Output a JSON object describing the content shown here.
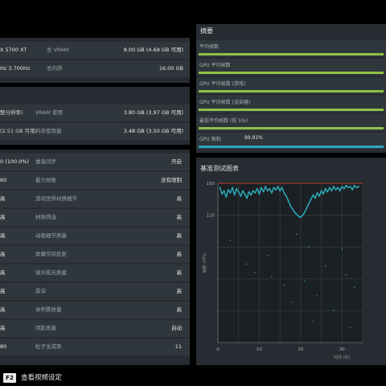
{
  "top_left": {
    "gpu": "X 5700 XT",
    "cpu": "Hz 3.700Hz",
    "vram_label": "总 VRAM",
    "vram_value": "8.00 GB (4.68 GB 可用)",
    "ram_label": "总内存",
    "ram_value": "16.00 GB"
  },
  "mid_left": {
    "left1": "整分辨率)",
    "left2": "(2.51 GB 可用)",
    "vram_use_label": "VRAM 使用",
    "vram_use_value": "3.80 GB (3.97 GB 可用)",
    "mem_use_label": "内存使用量",
    "mem_use_value": "3.48 GB (3.50 GB 可用)"
  },
  "summary": {
    "title": "摘要",
    "rows": [
      {
        "label": "平均帧数",
        "fill": 1.0,
        "color": "#8fc146"
      },
      {
        "label": "GPU 平均帧数",
        "fill": 1.0,
        "color": "#8fc146"
      },
      {
        "label": "GPU 平均帧数 (游戏)",
        "fill": 1.0,
        "color": "#8fc146"
      },
      {
        "label": "GPU 平均帧数 (渲染器)",
        "fill": 1.0,
        "color": "#8fc146"
      },
      {
        "label": "最低平均帧数 (低 5%)",
        "fill": 1.0,
        "color": "#8fc146"
      },
      {
        "label": "GPU 限制",
        "value": "99.91%",
        "fill": 0.9991,
        "color": "#2aa7c9"
      }
    ]
  },
  "settings": {
    "rows": [
      {
        "left": "0 (100.0%)",
        "label": "垂直同步",
        "value": "开启"
      },
      {
        "left": "60",
        "label": "最大帧数",
        "value": "没有限制"
      },
      {
        "left": "高",
        "label": "游戏世界材质细节",
        "value": "高"
      },
      {
        "left": "高",
        "label": "材质筛选",
        "value": "高"
      },
      {
        "left": "高",
        "label": "动画细节质量",
        "value": "高"
      },
      {
        "left": "高",
        "label": "屏幕空间反射",
        "value": "高"
      },
      {
        "left": "高",
        "label": "镜头眩光质量",
        "value": "高"
      },
      {
        "left": "高",
        "label": "景深",
        "value": "高"
      },
      {
        "left": "高",
        "label": "体积雾质量",
        "value": "高"
      },
      {
        "left": "高",
        "label": "阴影质量",
        "value": "自动"
      },
      {
        "left": "80",
        "label": "粒子生成率",
        "value": "11"
      }
    ]
  },
  "chart_title": "基准测试图表",
  "chart_data": {
    "type": "scatter",
    "title": "基准测试图表",
    "xlabel": "时间 (秒)",
    "ylabel": "帧数 (FPS)",
    "xlim": [
      0,
      35
    ],
    "ylim": [
      0,
      150
    ],
    "x_ticks": [
      "0",
      "10",
      "20",
      "30"
    ],
    "y_ticks": [
      "150",
      "120"
    ],
    "series_color": "#2bb3c0",
    "cap_line_color": "#c0392b",
    "samples": [
      [
        0.5,
        146
      ],
      [
        1,
        140
      ],
      [
        1.5,
        143
      ],
      [
        2,
        137
      ],
      [
        2.5,
        144
      ],
      [
        3,
        141
      ],
      [
        3.5,
        146
      ],
      [
        4,
        139
      ],
      [
        4.5,
        145
      ],
      [
        5,
        142
      ],
      [
        5.5,
        138
      ],
      [
        6,
        143
      ],
      [
        6.5,
        140
      ],
      [
        7,
        136
      ],
      [
        7.5,
        142
      ],
      [
        8,
        139
      ],
      [
        8.5,
        143
      ],
      [
        9,
        141
      ],
      [
        9.5,
        145
      ],
      [
        10,
        140
      ],
      [
        10.5,
        146
      ],
      [
        11,
        142
      ],
      [
        11.5,
        147
      ],
      [
        12,
        143
      ],
      [
        12.5,
        145
      ],
      [
        13,
        141
      ],
      [
        13.5,
        146
      ],
      [
        14,
        144
      ],
      [
        14.5,
        147
      ],
      [
        15,
        143
      ],
      [
        15.5,
        146
      ],
      [
        16,
        141
      ],
      [
        16.5,
        138
      ],
      [
        17,
        134
      ],
      [
        17.5,
        129
      ],
      [
        18,
        126
      ],
      [
        18.5,
        123
      ],
      [
        19,
        121
      ],
      [
        19.5,
        119
      ],
      [
        20,
        118
      ],
      [
        20.5,
        120
      ],
      [
        21,
        123
      ],
      [
        21.5,
        127
      ],
      [
        22,
        131
      ],
      [
        22.5,
        135
      ],
      [
        23,
        139
      ],
      [
        23.5,
        136
      ],
      [
        24,
        141
      ],
      [
        24.5,
        138
      ],
      [
        25,
        143
      ],
      [
        25.5,
        140
      ],
      [
        26,
        145
      ],
      [
        26.5,
        142
      ],
      [
        27,
        146
      ],
      [
        27.5,
        143
      ],
      [
        28,
        147
      ],
      [
        28.5,
        144
      ],
      [
        29,
        146
      ],
      [
        29.5,
        143
      ],
      [
        30,
        147
      ],
      [
        30.5,
        145
      ],
      [
        31,
        148
      ],
      [
        31.5,
        146
      ],
      [
        32,
        147
      ],
      [
        32.5,
        144
      ],
      [
        33,
        148
      ],
      [
        33.5,
        146
      ],
      [
        34,
        147
      ]
    ],
    "outliers": [
      [
        3,
        96
      ],
      [
        7,
        74
      ],
      [
        9,
        66
      ],
      [
        12,
        82
      ],
      [
        13,
        62
      ],
      [
        16,
        54
      ],
      [
        18,
        38
      ],
      [
        19,
        102
      ],
      [
        21,
        58
      ],
      [
        22,
        90
      ],
      [
        23,
        20
      ],
      [
        24,
        44
      ],
      [
        26,
        72
      ],
      [
        28,
        30
      ],
      [
        30,
        88
      ],
      [
        31,
        64
      ],
      [
        32,
        14
      ],
      [
        33,
        52
      ]
    ]
  },
  "footer": {
    "key": "F2",
    "text": "查看视频设定"
  }
}
